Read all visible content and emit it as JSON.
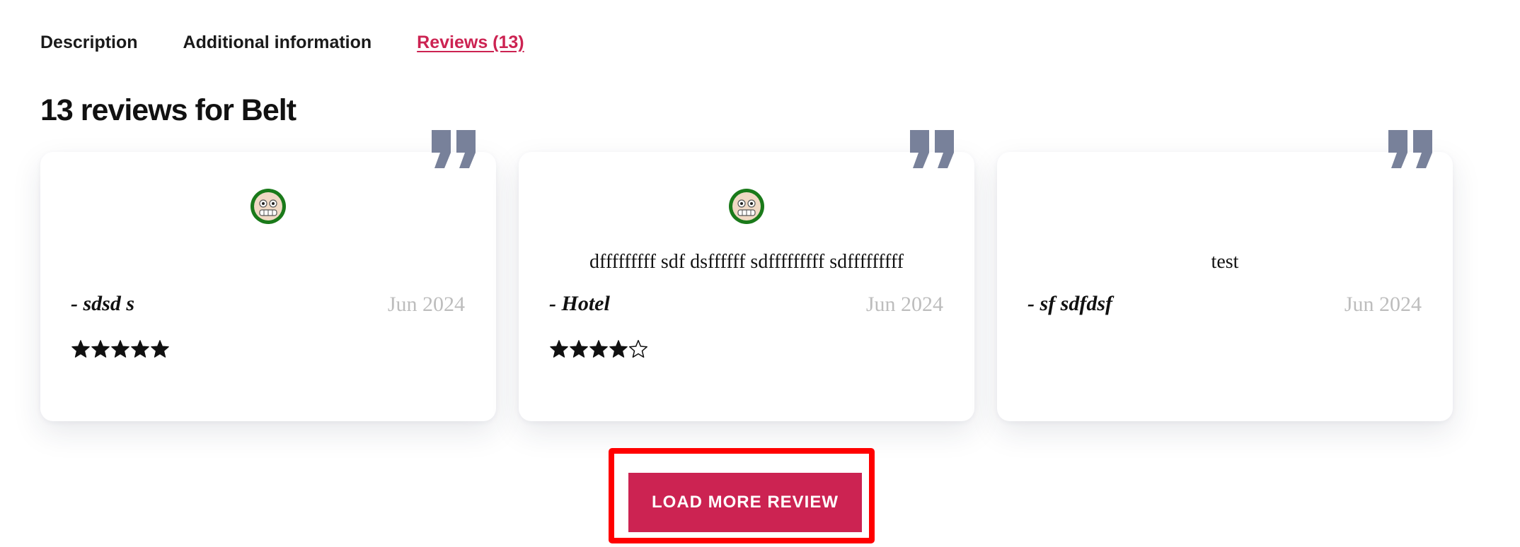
{
  "tabs": [
    {
      "label": "Description",
      "active": false
    },
    {
      "label": "Additional information",
      "active": false
    },
    {
      "label": "Reviews (13)",
      "active": true
    }
  ],
  "heading": "13 reviews for Belt",
  "reviews": [
    {
      "text": "",
      "author": "- sdsd s",
      "date": "Jun 2024",
      "rating": 5,
      "has_avatar": true
    },
    {
      "text": "dfffffffff sdf dsffffff sdfffffffff sdfffffffff",
      "author": "- Hotel",
      "date": "Jun 2024",
      "rating": 4,
      "has_avatar": true
    },
    {
      "text": "test",
      "author": "- sf sdfdsf",
      "date": "Jun 2024",
      "rating": 0,
      "has_avatar": false
    }
  ],
  "rating_max": 5,
  "load_more_label": "LOAD MORE REVIEW",
  "colors": {
    "accent": "#cc2352",
    "quote_mark": "#78819a",
    "highlight": "#ff0000",
    "avatar_ring": "#1a7a1a",
    "date_text": "#bdbdbd"
  },
  "icons": {
    "quote": "quote-icon",
    "avatar": "avatar-icon",
    "star_filled": "star-filled-icon",
    "star_empty": "star-empty-icon"
  }
}
